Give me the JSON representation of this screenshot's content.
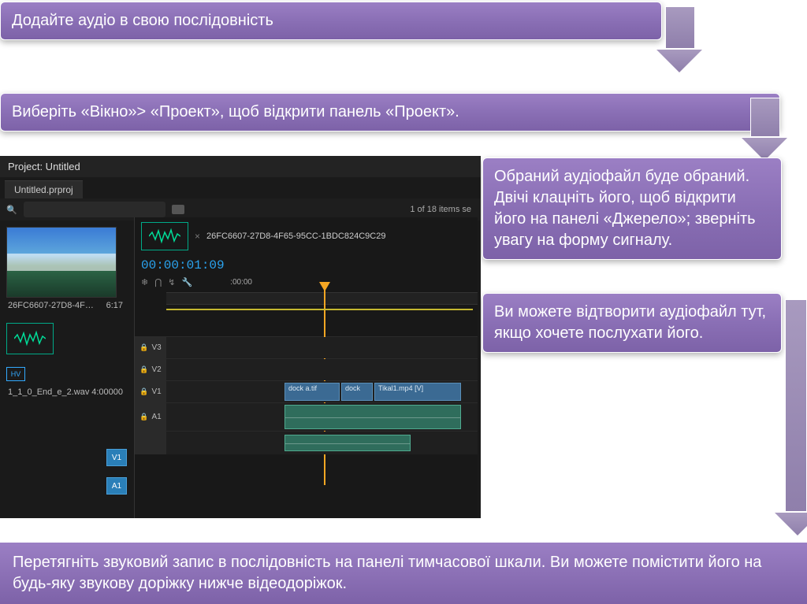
{
  "callouts": {
    "c1": "Додайте аудіо в свою послідовність",
    "c2": "Виберіть «Вікно»> «Проект», щоб відкрити панель «Проект».",
    "c3": "Обраний аудіофайл буде обраний. Двічі клацніть його, щоб відкрити його на панелі «Джерело»; зверніть увагу на форму сигналу.",
    "c4": "Ви можете відтворити аудіофайл тут, якщо хочете послухати його.",
    "c5": "Перетягніть звуковий запис в послідовність на панелі тимчасової шкали. Ви можете помістити його на будь-яку звукову доріжку нижче відеодоріжок."
  },
  "project": {
    "title": "Project: Untitled",
    "tab": "Untitled.prproj",
    "search_placeholder": "",
    "items_count": "1 of 18 items se",
    "thumb_name": "26FC6607-27D8-4F…",
    "thumb_dur": "6:17",
    "wave_name": "1_1_0_End_e_2.wav",
    "wave_dur": "4:00000"
  },
  "source": {
    "clip_name": "26FC6607-27D8-4F65-95CC-1BDC824C9C29",
    "timecode": "00:00:01:09",
    "ruler": ":00:00"
  },
  "tracks": {
    "v3": "V3",
    "v2": "V2",
    "v1": "V1",
    "src_v1": "V1",
    "src_a1": "A1",
    "a1": "A1",
    "clip_a": "dock a.tif",
    "clip_b": "dock",
    "clip_c": "Tikal1.mp4 [V]"
  }
}
